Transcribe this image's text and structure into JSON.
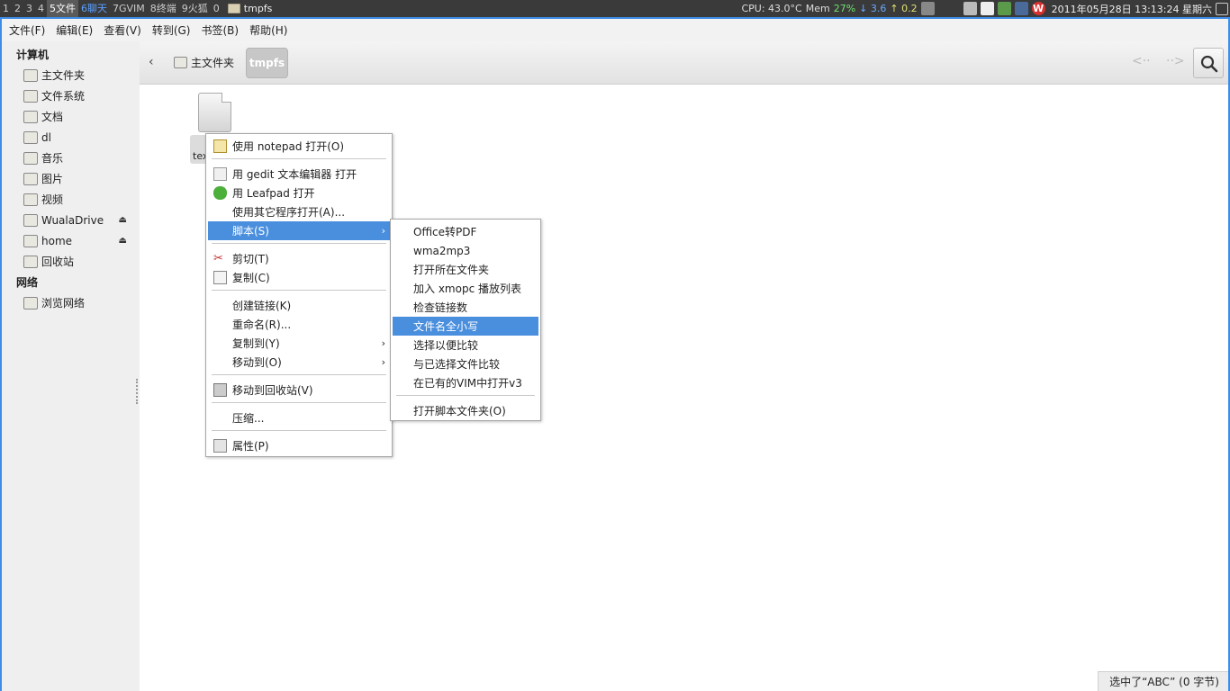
{
  "panel": {
    "workspaces": [
      "1",
      "2",
      "3",
      "4",
      "5文件",
      "6聊天",
      "7GVIM",
      "8终端",
      "9火狐",
      "0"
    ],
    "active_workspace": "5文件",
    "window_title": "tmpfs",
    "cpu": "CPU: 43.0°C",
    "mem_label": "Mem",
    "mem_value": "27%",
    "net_down": "↓ 3.6",
    "net_up": "↑ 0.2",
    "clock": "2011年05月28日 13:13:24 星期六"
  },
  "menubar": [
    "文件(F)",
    "编辑(E)",
    "查看(V)",
    "转到(G)",
    "书签(B)",
    "帮助(H)"
  ],
  "sidebar": {
    "computer_header": "计算机",
    "items": [
      {
        "label": "主文件夹",
        "icon": "home-folder-icon"
      },
      {
        "label": "文件系统",
        "icon": "drive-icon"
      },
      {
        "label": "文档",
        "icon": "documents-folder-icon"
      },
      {
        "label": "dl",
        "icon": "download-folder-icon"
      },
      {
        "label": "音乐",
        "icon": "music-folder-icon"
      },
      {
        "label": "图片",
        "icon": "pictures-folder-icon"
      },
      {
        "label": "视频",
        "icon": "videos-folder-icon"
      },
      {
        "label": "WualaDrive",
        "icon": "drive-icon",
        "eject": true
      },
      {
        "label": "home",
        "icon": "drive-icon",
        "eject": true
      },
      {
        "label": "回收站",
        "icon": "trash-icon"
      }
    ],
    "network_header": "网络",
    "network_items": [
      {
        "label": "浏览网络",
        "icon": "network-icon"
      }
    ]
  },
  "toolbar": {
    "back": "‹",
    "crumb_home": "主文件夹",
    "crumb_current": "tmpfs"
  },
  "file": {
    "label_partial": "tex"
  },
  "context_menu": {
    "items": [
      {
        "label": "使用 notepad 打开(O)",
        "icon": "notepad-icon"
      },
      {
        "label": "用 gedit 文本编辑器 打开",
        "icon": "gedit-icon"
      },
      {
        "label": "用 Leafpad 打开",
        "icon": "leafpad-icon"
      },
      {
        "label": "使用其它程序打开(A)..."
      },
      {
        "label": "脚本(S)",
        "submenu": true,
        "highlighted": true
      },
      {
        "label": "剪切(T)",
        "icon": "scissors-icon"
      },
      {
        "label": "复制(C)",
        "icon": "copy-icon"
      },
      {
        "label": "创建链接(K)"
      },
      {
        "label": "重命名(R)..."
      },
      {
        "label": "复制到(Y)",
        "submenu": true
      },
      {
        "label": "移动到(O)",
        "submenu": true
      },
      {
        "label": "移动到回收站(V)",
        "icon": "trash-icon"
      },
      {
        "label": "压缩..."
      },
      {
        "label": "属性(P)",
        "icon": "properties-icon"
      }
    ]
  },
  "scripts_submenu": {
    "items": [
      "Office转PDF",
      "wma2mp3",
      "打开所在文件夹",
      "加入 xmopc 播放列表",
      "检查链接数",
      "文件名全小写",
      "选择以便比较",
      "与已选择文件比较",
      "在已有的VIM中打开v3",
      "打开脚本文件夹(O)"
    ],
    "highlighted": "文件名全小写"
  },
  "statusbar": "选中了“ABC” (0 字节)",
  "colors": {
    "accent": "#4a8fde",
    "window_border": "#3d8de8",
    "panel_bg": "#3a3a3a"
  }
}
